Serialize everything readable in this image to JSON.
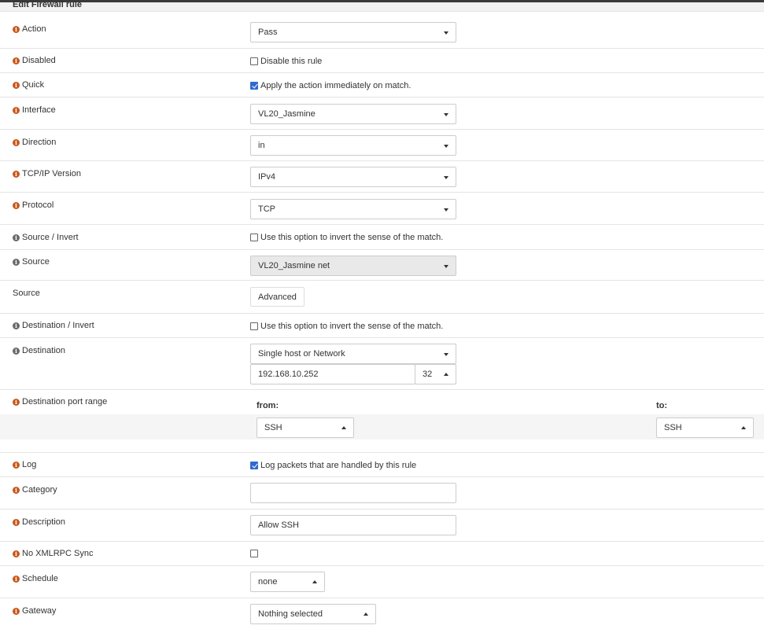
{
  "page_title": "Edit Firewall rule",
  "fields": {
    "action": {
      "label": "Action",
      "value": "Pass"
    },
    "disabled": {
      "label": "Disabled",
      "checkbox_label": "Disable this rule",
      "checked": false
    },
    "quick": {
      "label": "Quick",
      "checkbox_label": "Apply the action immediately on match.",
      "checked": true
    },
    "interface": {
      "label": "Interface",
      "value": "VL20_Jasmine"
    },
    "direction": {
      "label": "Direction",
      "value": "in"
    },
    "ipversion": {
      "label": "TCP/IP Version",
      "value": "IPv4"
    },
    "protocol": {
      "label": "Protocol",
      "value": "TCP"
    },
    "source_invert": {
      "label": "Source / Invert",
      "checkbox_label": "Use this option to invert the sense of the match.",
      "checked": false
    },
    "source": {
      "label": "Source",
      "value": "VL20_Jasmine net"
    },
    "source_advanced": {
      "label": "Source",
      "button_label": "Advanced"
    },
    "destination_invert": {
      "label": "Destination / Invert",
      "checkbox_label": "Use this option to invert the sense of the match.",
      "checked": false
    },
    "destination": {
      "label": "Destination",
      "type_value": "Single host or Network",
      "address_value": "192.168.10.252",
      "mask_value": "32"
    },
    "port_range": {
      "label": "Destination port range",
      "from_label": "from:",
      "to_label": "to:",
      "from_value": "SSH",
      "to_value": "SSH"
    },
    "log": {
      "label": "Log",
      "checkbox_label": "Log packets that are handled by this rule",
      "checked": true
    },
    "category": {
      "label": "Category",
      "value": ""
    },
    "description": {
      "label": "Description",
      "value": "Allow SSH"
    },
    "xmlrpc": {
      "label": "No XMLRPC Sync",
      "checked": false
    },
    "schedule": {
      "label": "Schedule",
      "value": "none"
    },
    "gateway": {
      "label": "Gateway",
      "value": "Nothing selected"
    }
  },
  "colors": {
    "info_icon": "#c9581b",
    "checkbox_checked": "#2f6ad0"
  }
}
